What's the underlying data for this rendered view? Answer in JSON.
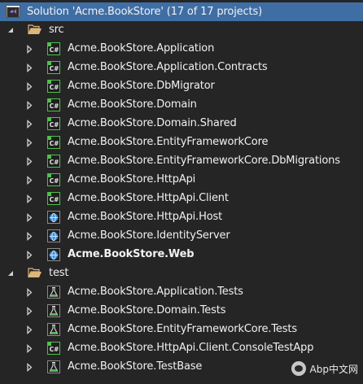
{
  "solution": {
    "label": "Solution 'Acme.BookStore' (17 of 17 projects)"
  },
  "folders": {
    "src": "src",
    "test": "test"
  },
  "src_projects": [
    {
      "label": "Acme.BookStore.Application",
      "icon": "csharp-project-icon"
    },
    {
      "label": "Acme.BookStore.Application.Contracts",
      "icon": "csharp-project-icon"
    },
    {
      "label": "Acme.BookStore.DbMigrator",
      "icon": "csharp-project-icon"
    },
    {
      "label": "Acme.BookStore.Domain",
      "icon": "csharp-project-icon"
    },
    {
      "label": "Acme.BookStore.Domain.Shared",
      "icon": "csharp-project-icon"
    },
    {
      "label": "Acme.BookStore.EntityFrameworkCore",
      "icon": "csharp-project-icon"
    },
    {
      "label": "Acme.BookStore.EntityFrameworkCore.DbMigrations",
      "icon": "csharp-project-icon"
    },
    {
      "label": "Acme.BookStore.HttpApi",
      "icon": "csharp-project-icon"
    },
    {
      "label": "Acme.BookStore.HttpApi.Client",
      "icon": "csharp-project-icon"
    },
    {
      "label": "Acme.BookStore.HttpApi.Host",
      "icon": "web-project-icon"
    },
    {
      "label": "Acme.BookStore.IdentityServer",
      "icon": "web-project-icon"
    },
    {
      "label": "Acme.BookStore.Web",
      "icon": "web-project-icon",
      "startup": true
    }
  ],
  "test_projects": [
    {
      "label": "Acme.BookStore.Application.Tests",
      "icon": "test-project-icon"
    },
    {
      "label": "Acme.BookStore.Domain.Tests",
      "icon": "test-project-icon"
    },
    {
      "label": "Acme.BookStore.EntityFrameworkCore.Tests",
      "icon": "test-project-icon"
    },
    {
      "label": "Acme.BookStore.HttpApi.Client.ConsoleTestApp",
      "icon": "csharp-project-icon"
    },
    {
      "label": "Acme.BookStore.TestBase",
      "icon": "test-project-icon"
    }
  ],
  "watermark": "Abp中文网",
  "colors": {
    "background": "#252526",
    "selection": "#3f6ea5",
    "csharp": "#4ec14a",
    "web": "#3c8fdc",
    "folder": "#dcb67a"
  }
}
